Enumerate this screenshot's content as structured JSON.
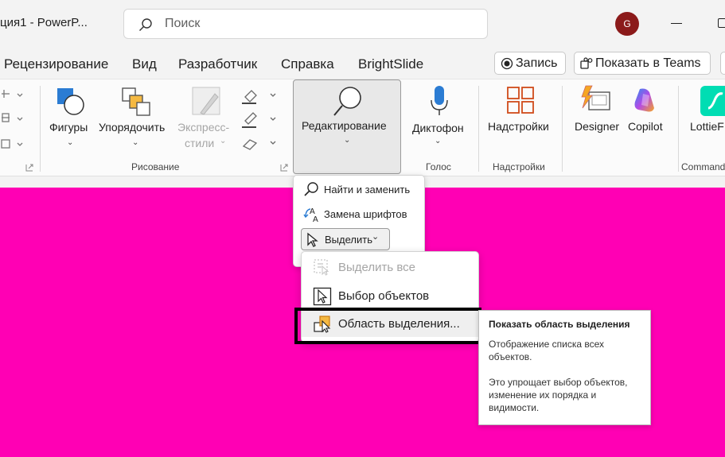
{
  "window": {
    "title": "ция1 - PowerP...",
    "user_initial": "G"
  },
  "search": {
    "placeholder": "Поиск"
  },
  "tabs": [
    "Рецензирование",
    "Вид",
    "Разработчик",
    "Справка",
    "BrightSlide"
  ],
  "actions": {
    "record": "Запись",
    "present_teams": "Показать в Teams"
  },
  "ribbon": {
    "drawing": {
      "shapes": "Фигуры",
      "arrange": "Упорядочить",
      "quick_styles_1": "Экспресс-",
      "quick_styles_2": "стили",
      "group_label": "Рисование"
    },
    "editing": {
      "label": "Редактирование"
    },
    "voice": {
      "dictate": "Диктофон",
      "group_label": "Голос"
    },
    "addins": {
      "addins": "Надстройки",
      "group_label": "Надстройки"
    },
    "designer": "Designer",
    "copilot": "Copilot",
    "lottie": "LottieF",
    "commands_label": "Commands"
  },
  "editing_menu": {
    "find_replace": "Найти и заменить",
    "replace_fonts": "Замена шрифтов",
    "select": "Выделить"
  },
  "select_submenu": {
    "select_all": "Выделить все",
    "select_objects": "Выбор объектов",
    "selection_pane": "Область выделения..."
  },
  "tooltip": {
    "title": "Показать область выделения",
    "p1": "Отображение списка всех объектов.",
    "p2": "Это упрощает выбор объектов, изменение их порядка и видимости."
  },
  "colors": {
    "slide_bg": "#ff00b4",
    "accent_orange": "#d04a1a",
    "avatar": "#8b1a1a"
  }
}
